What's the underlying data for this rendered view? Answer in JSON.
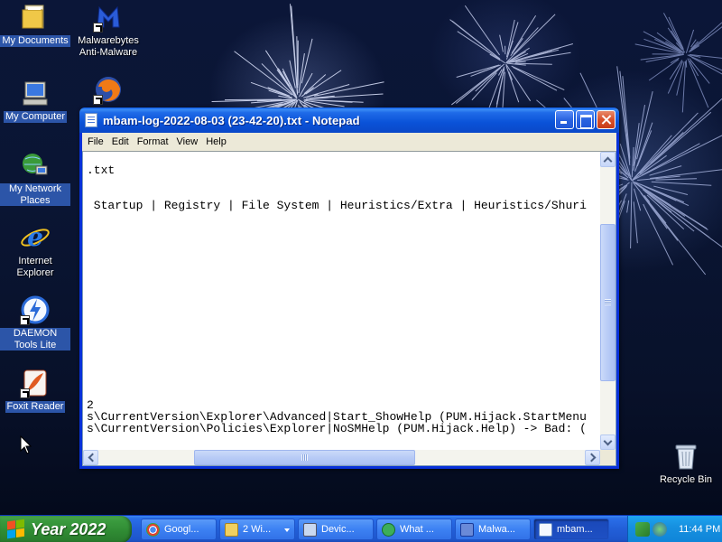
{
  "desktop": {
    "icons": [
      {
        "label": "My Documents",
        "icon": "folder-documents-icon"
      },
      {
        "label": "Malwarebytes Anti-Malware",
        "icon": "malwarebytes-icon"
      },
      {
        "label": "My Computer",
        "icon": "computer-icon"
      },
      {
        "label": "My Network Places",
        "icon": "network-icon"
      },
      {
        "label": "Internet Explorer",
        "icon": "internet-explorer-icon"
      },
      {
        "label": "DAEMON Tools Lite",
        "icon": "daemon-tools-icon"
      },
      {
        "label": "Foxit Reader",
        "icon": "foxit-reader-icon"
      },
      {
        "label": "Recycle Bin",
        "icon": "recycle-bin-icon"
      },
      {
        "label": "",
        "icon": "firefox-icon"
      }
    ]
  },
  "window": {
    "title": "mbam-log-2022-08-03 (23-42-20).txt - Notepad",
    "menu": [
      "File",
      "Edit",
      "Format",
      "View",
      "Help"
    ],
    "lines": {
      "l1": ".txt",
      "l2": " Startup | Registry | File System | Heuristics/Extra | Heuristics/Shuri",
      "l3": "2",
      "l4": "s\\CurrentVersion\\Explorer\\Advanced|Start_ShowHelp (PUM.Hijack.StartMenu",
      "l5": "s\\CurrentVersion\\Policies\\Explorer|NoSMHelp (PUM.Hijack.Help) -> Bad: ("
    }
  },
  "taskbar": {
    "start_label": "Year 2022",
    "tasks": [
      {
        "label": "Googl...",
        "icon": "chrome-icon",
        "color": "#e8e8e8",
        "active": false,
        "group": false
      },
      {
        "label": "2 Wi...",
        "icon": "folder-icon",
        "color": "#f0d060",
        "active": false,
        "group": true
      },
      {
        "label": "Devic...",
        "icon": "device-manager-icon",
        "color": "#c8d8f0",
        "active": false,
        "group": false
      },
      {
        "label": "What ...",
        "icon": "browser-n-icon",
        "color": "#3cae5a",
        "active": false,
        "group": false
      },
      {
        "label": "Malwa...",
        "icon": "malwarebytes-icon",
        "color": "#6a8ad8",
        "active": false,
        "group": false
      },
      {
        "label": "mbam...",
        "icon": "notepad-icon",
        "color": "#bcd4f4",
        "active": true,
        "group": false
      }
    ],
    "clock": "11:44 PM"
  },
  "colors": {
    "xp_blue": "#0831d9",
    "start_green": "#3b9c3f",
    "tray_blue": "#1690e0"
  }
}
